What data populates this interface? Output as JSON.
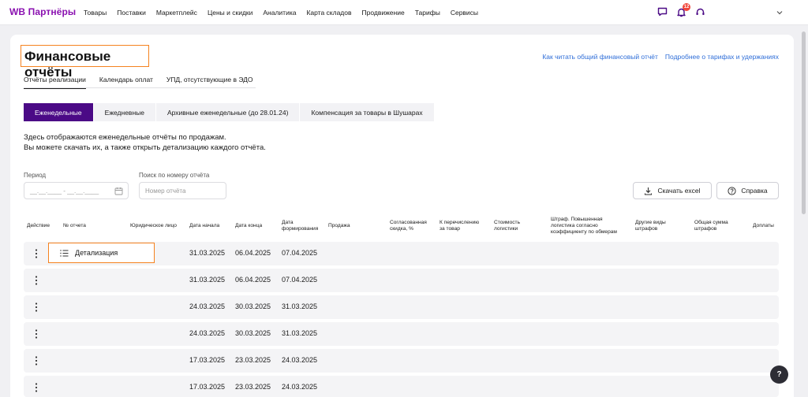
{
  "header": {
    "logo": "WB Партнёры",
    "nav": [
      "Товары",
      "Поставки",
      "Маркетплейс",
      "Цены и скидки",
      "Аналитика",
      "Карта складов",
      "Продвижение",
      "Тарифы",
      "Сервисы"
    ],
    "notification_count": "12"
  },
  "page": {
    "title": "Финансовые отчёты",
    "help_links": [
      "Как читать общий финансовый отчёт",
      "Подробнее о тарифах и удержаниях"
    ],
    "subtabs": [
      "Отчёты реализации",
      "Календарь оплат",
      "УПД, отсутствующие в ЭДО"
    ],
    "segments": [
      "Еженедельные",
      "Ежедневные",
      "Архивные еженедельные (до 28.01.24)",
      "Компенсация за товары в Шушарах"
    ],
    "description_line1": "Здесь отображаются еженедельные отчёты по продажам.",
    "description_line2": "Вы можете скачать их, а также открыть детализацию каждого отчёта."
  },
  "filters": {
    "period_label": "Период",
    "period_placeholder": "__.__.____ - __.__.____",
    "search_label": "Поиск по номеру отчёта",
    "search_placeholder": "Номер отчёта",
    "excel_button": "Скачать excel",
    "help_button": "Справка"
  },
  "table": {
    "headers": {
      "action": "Действие",
      "number": "№ отчета",
      "entity": "Юридическое лицо",
      "start": "Дата начала",
      "end": "Дата конца",
      "formed_1": "Дата",
      "formed_2": "формирования",
      "sale": "Продажа",
      "discount_1": "Согласованная",
      "discount_2": "скидка, %",
      "transfer_1": "К перечислению",
      "transfer_2": "за товар",
      "logistics_1": "Стоимость",
      "logistics_2": "логистики",
      "fine_1": "Штраф. Повышенная",
      "fine_2": "логистика согласно",
      "fine_3": "коэффициенту по обмерам",
      "other_1": "Другие виды",
      "other_2": "штрафов",
      "total_1": "Общая сумма",
      "total_2": "штрафов",
      "extra": "Доплаты"
    },
    "detail_label": "Детализация",
    "rows": [
      {
        "start": "31.03.2025",
        "end": "06.04.2025",
        "formed": "07.04.2025"
      },
      {
        "start": "31.03.2025",
        "end": "06.04.2025",
        "formed": "07.04.2025"
      },
      {
        "start": "24.03.2025",
        "end": "30.03.2025",
        "formed": "31.03.2025"
      },
      {
        "start": "24.03.2025",
        "end": "30.03.2025",
        "formed": "31.03.2025"
      },
      {
        "start": "17.03.2025",
        "end": "23.03.2025",
        "formed": "24.03.2025"
      },
      {
        "start": "17.03.2025",
        "end": "23.03.2025",
        "formed": "24.03.2025"
      }
    ]
  },
  "fab_label": "?"
}
